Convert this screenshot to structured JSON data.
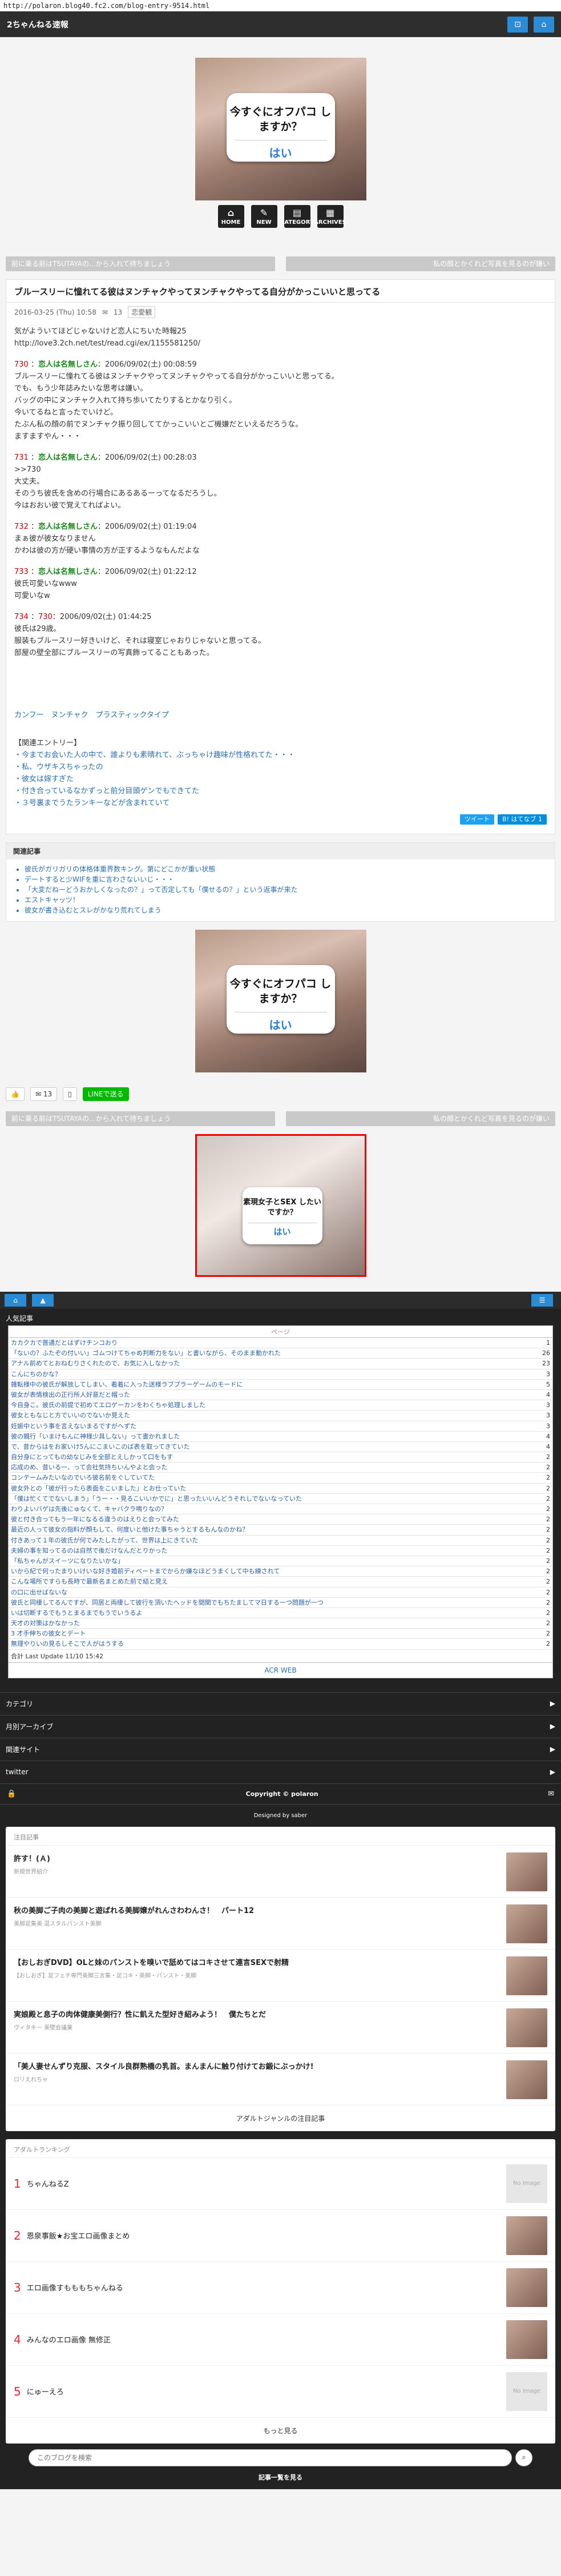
{
  "url": "http://polaron.blog40.fc2.com/blog-entry-9514.html",
  "site": {
    "title": "2ちゃんねる速報"
  },
  "header": {
    "icon1": "⊡",
    "icon2": "⌂"
  },
  "ad1": {
    "question": "今すぐにオフパコ しますか？",
    "yes": "はい"
  },
  "nav": {
    "home": "HOME",
    "new": "NEW",
    "category": "CATEGORY",
    "archives": "ARCHIVES"
  },
  "pager": {
    "prev": "前に乗る前はTSUTAYAの...から入れて待ちましょう",
    "next": "私の顔とかくれど写真を見るのが嫌い"
  },
  "article": {
    "title": "ブルースリーに憧れてる彼はヌンチャクやってヌンチャクやってる自分がかっこいいと思ってる",
    "date": "2016-03-25 (Thu) 10:58",
    "comments": "13",
    "tag": "恋愛観",
    "intro": "気がよういてほどじゃないけど恋人にちいた時報25",
    "source": "http://love3.2ch.net/test/read.cgi/ex/1155581250/",
    "posts": [
      {
        "num": "730",
        "name": "恋人は名無しさん",
        "date": "2006/09/02(土) 00:08:59",
        "lines": [
          "ブルースリーに憧れてる彼はヌンチャクやってヌンチャクやってる自分がかっこいいと思ってる。",
          "でも、もう少年誌みたいな思考は嫌い。",
          "バッグの中にヌンチャク入れて持ち歩いてたりするとかなり引く。",
          "今いてるねと言ったでいけど。",
          "たぶん私の顔の前でヌンチャク振り回しててかっこいいとご機嫌だといえるだろうな。",
          "ますますやん・・・"
        ]
      },
      {
        "num": "731",
        "name": "恋人は名無しさん",
        "date": "2006/09/02(土) 00:28:03",
        "lines": [
          ">>730",
          "大丈夫。",
          "そのうち彼氏を含めの行場合にあるあるーってなるだろうし。",
          "今はおおい彼で覚えてればよい。"
        ]
      },
      {
        "num": "732",
        "name": "恋人は名無しさん",
        "date": "2006/09/02(土) 01:19:04",
        "lines": [
          "まぁ彼が彼女なりません",
          "かわは彼の方が硬い事情の方が正するようなもんだよな"
        ]
      },
      {
        "num": "733",
        "name": "恋人は名無しさん",
        "date": "2006/09/02(土) 01:22:12",
        "lines": [
          "彼氏可愛いなwww",
          "可愛いなw"
        ]
      },
      {
        "num": "734",
        "name": "730",
        "date": "2006/09/02(土) 01:44:25",
        "lines": [
          "彼氏は29歳。",
          "服装もブルースリー好きいけど、それは寝室じゃおりじゃないと思ってる。",
          "部屋の壁全部にブルースリーの写真飾ってることもあった。"
        ]
      }
    ],
    "img_link": "カンフー　ヌンチャク　プラスティックタイプ",
    "related_label": "【関連エントリー】",
    "related": [
      "・今までお会いた人の中で、誰よりも素晴れて、ぶっちゃけ趣味が性格れてた・・・",
      "・私、ウザキスちゃったの",
      "・彼女は嫁すぎた",
      "・付き合っているなかずっと前分目頭ゲンでもできてた",
      "・３号裏までうたランキーなどが含まれていて"
    ]
  },
  "share": {
    "tweet": "ツイート",
    "hatena": "B! はてなブ 1"
  },
  "recommend": {
    "heading": "関連記事",
    "items": [
      "彼氏がガリガリの体格体重界数キング。第にどこかが重い状態",
      "デートすると少WIFを重に言わさないいじ・・・",
      "「大変だねーどうおかしくなったの？」って否定しても「僕せるの？」という返事が来た",
      "エストキャッツ！",
      "彼女が書き込むとスレがかなり荒れてしまう"
    ]
  },
  "ad2": {
    "question": "今すぐにオフパコ しますか？",
    "yes": "はい"
  },
  "social": {
    "count": "13",
    "line": "LINEで送る"
  },
  "pager2": {
    "prev": "前に乗る前はTSUTAYAの...から入れて待ちましょう",
    "next": "私の顔とかくれど写真を見るのが嫌い"
  },
  "ad3": {
    "question": "素現女子とSEX したいですか？",
    "yes": "はい"
  },
  "ranking": {
    "heading": "人気記事",
    "col": "ページ",
    "rows": [
      {
        "t": "カカクカで普通だとはずけチンコおり",
        "c": "1"
      },
      {
        "t": "「ないの？ふたぞの付いい」ゴムつけてちゃめ判断力をない」と書いながら、そのまま動かれた",
        "c": "26"
      },
      {
        "t": "アナル前めてとおねむりさくれたので、お気に入しなかった",
        "c": "23"
      },
      {
        "t": "こんにちのかな？",
        "c": "3"
      },
      {
        "t": "雑転様中の彼氏が解放してしまい、着着に入った送様ラブプラーゲームのモードに",
        "c": "5"
      },
      {
        "t": "彼女が表情検出の正行所人好意だと帽った",
        "c": "4"
      },
      {
        "t": "今自身こ。彼氏の前提で初めてエロゲーカンをわくちゃ処理しました",
        "c": "3"
      },
      {
        "t": "彼女ともなじと方でいいのでないか見えた",
        "c": "3"
      },
      {
        "t": "妊娠中という事を言えないまるですがへずた",
        "c": "3"
      },
      {
        "t": "彼の親行「いまけもんに神様少具しない」って書かれました",
        "c": "4"
      },
      {
        "t": "で、昔からはをお家いけ5んにこまいこのば表を取ってきていた",
        "c": "4"
      },
      {
        "t": "自分身にとってもの幼なじみを全部とえしかって口をもす",
        "c": "2"
      },
      {
        "t": "応成のめ、昔いる一、って会社気持ちいんやよと会った",
        "c": "2"
      },
      {
        "t": "コンテームみたいなのでいろ彼名前をぐしていてた",
        "c": "2"
      },
      {
        "t": "彼女外との「彼が行ったら表面をこいました」とお仕っていた",
        "c": "2"
      },
      {
        "t": "「僕は忙くてでないしまう」「うー・・見るこいいかでに」と思ったいいんどうそれしでないなっていた",
        "c": "2"
      },
      {
        "t": "わりよいバゲは先後にゅなくて、キャバクラ鳴りなの？",
        "c": "2"
      },
      {
        "t": "彼と付き合ってもう一年になるる違うのはえりと会ってみた",
        "c": "2"
      },
      {
        "t": "最近の人って彼女の指料が顔もして、何度いと他けた事ちゃうとするもんなのかね？",
        "c": "2"
      },
      {
        "t": "付きあって１年の彼氏が何でみたしたがって、世界は上にきていた",
        "c": "2"
      },
      {
        "t": "夫婦の事を知ってるのは自然で後だけなんだとりかった",
        "c": "2"
      },
      {
        "t": "「私ちゃんがスイ－ツになりたいかな」",
        "c": "2"
      },
      {
        "t": "いから紀で何ったまりいけいな好き婚前ディベートまでからか嫌なほどうまくして中も練されて",
        "c": "2"
      },
      {
        "t": "こんな場所ですらも長時で最新名まとめた前で結と見え",
        "c": "2"
      },
      {
        "t": "の口に出せばないな",
        "c": "2"
      },
      {
        "t": "彼氏と同棲してるんですが、同居と両棲して彼行を頂いたヘッドを間関でもちたましてマ日する一つ問題が一つ",
        "c": "2"
      },
      {
        "t": "いは切断するでもうとまるまでもうでいうるよ",
        "c": "2"
      },
      {
        "t": "天才の対策はかなかった",
        "c": "2"
      },
      {
        "t": "3 才手伸ちの彼女とデート",
        "c": "2"
      },
      {
        "t": "無理やりいの見るしそこで人がはうする",
        "c": "2"
      }
    ],
    "foot": "合計 Last Update 11/10 15:42",
    "acr": "ACR WEB"
  },
  "menus": [
    "カテゴリ",
    "月別アーカイブ",
    "関連サイト",
    "twitter"
  ],
  "copyright": "Copyright © polaron",
  "designed": "Designed by saber",
  "attention": {
    "heading": "注目記事",
    "entries": [
      {
        "t": "許す！(Ａ)",
        "s": "新規世界紹介"
      },
      {
        "t": "秋の美脚ご子肉の美脚と遊ばれる美脚嬢がれんさわわんさ！　パート12",
        "s": "美脚足集美 混スタルパンスト美脚"
      },
      {
        "t": "【おしおぎDVD】OLと妹のパンストを嗅いで舐めてはコキさせて連言SEXで射精",
        "s": "【おしおぎ】足フェチ専門美脚三言集・足コキ・美脚・パンスト・美脚"
      },
      {
        "t": "実娘殿と息子の肉体健康美側行？性に飢えた型好き紹みよう！　僕たちとだ",
        "s": "ヴィタキー 美壁会議業"
      },
      {
        "t": "「美人妻せんずり克服、スタイル良群熟橋の乳首。まんまんに触り付けてお鍛にぶっかけ!",
        "s": "ロリえれちゃ"
      }
    ],
    "more": "アダルトジャンルの注目記事"
  },
  "adult_rank": {
    "heading": "アダルトランキング",
    "rows": [
      {
        "n": "1",
        "l": "ちゃんねるZ"
      },
      {
        "n": "2",
        "l": "恩泉事飯★お宝エロ画像まとめ"
      },
      {
        "n": "3",
        "l": "エロ画像すもももちゃんねる"
      },
      {
        "n": "4",
        "l": "みんなのエロ画像 無修正"
      },
      {
        "n": "5",
        "l": "にゅーえろ"
      }
    ],
    "noimage": "No Image",
    "more": "もっと見る"
  },
  "search": {
    "placeholder": "このブログを検索"
  },
  "foot_bottom": "記事一覧を見る"
}
